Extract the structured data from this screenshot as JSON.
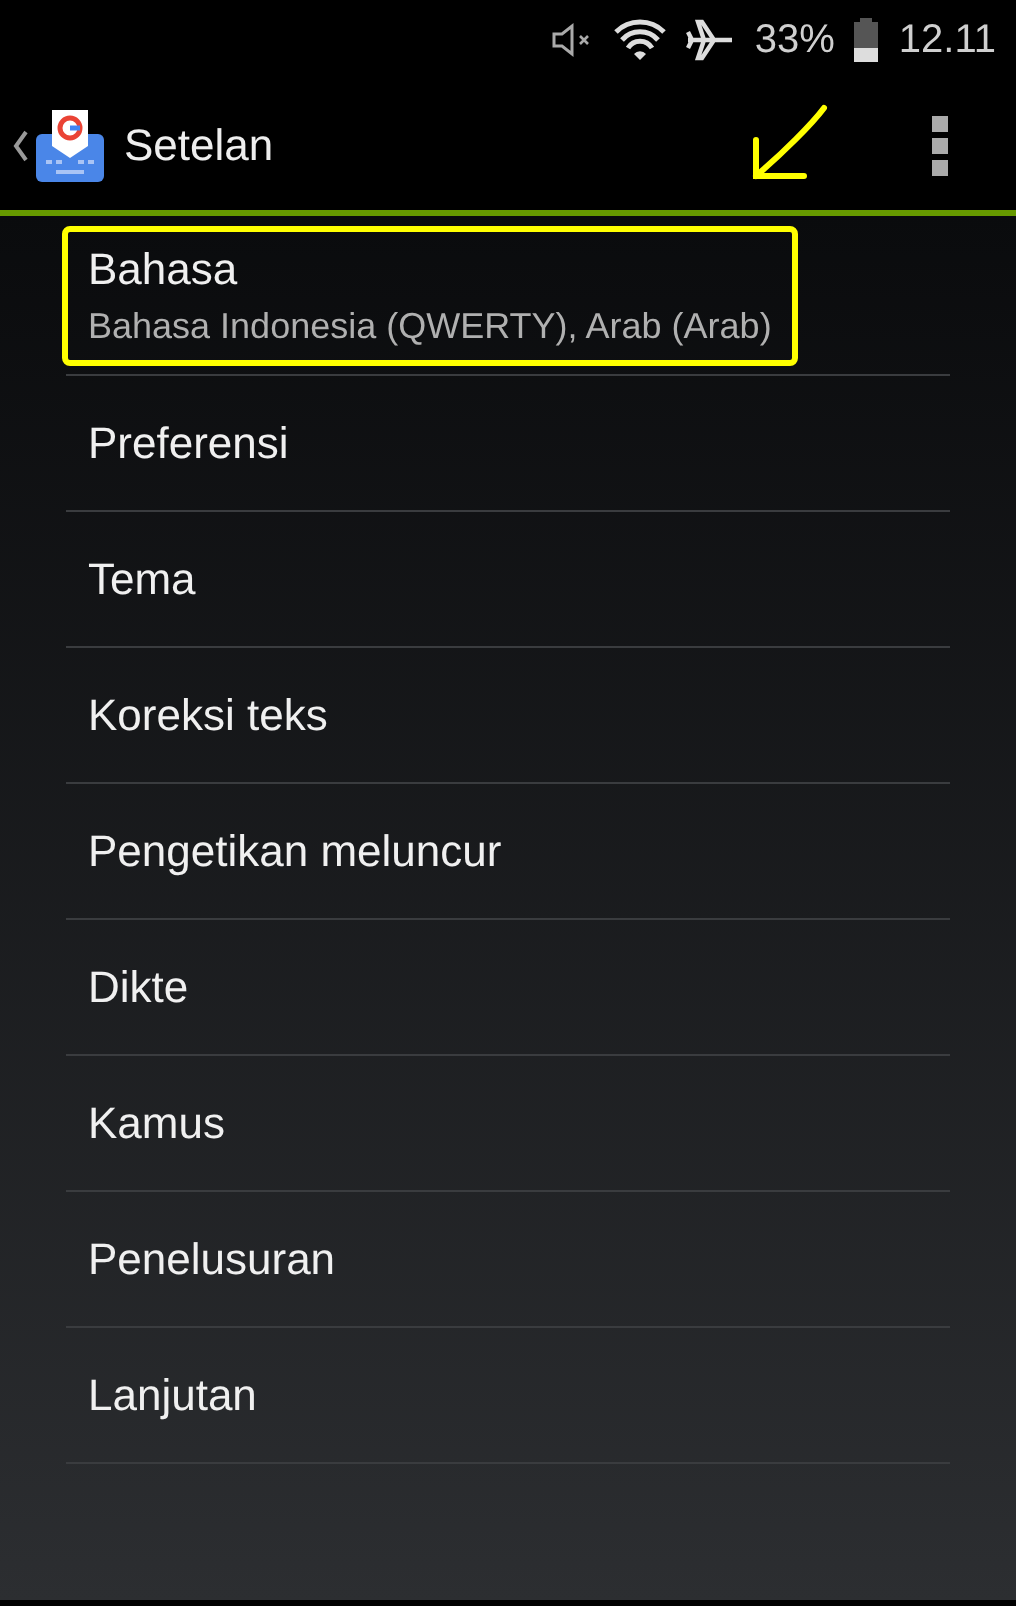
{
  "status_bar": {
    "battery": "33%",
    "time": "12.11"
  },
  "app_bar": {
    "title": "Setelan"
  },
  "items": [
    {
      "title": "Bahasa",
      "subtitle": "Bahasa Indonesia (QWERTY), Arab (Arab)",
      "highlighted": true
    },
    {
      "title": "Preferensi",
      "highlighted": false
    },
    {
      "title": "Tema",
      "highlighted": false
    },
    {
      "title": "Koreksi teks",
      "highlighted": false
    },
    {
      "title": "Pengetikan meluncur",
      "highlighted": false
    },
    {
      "title": "Dikte",
      "highlighted": false
    },
    {
      "title": "Kamus",
      "highlighted": false
    },
    {
      "title": "Penelusuran",
      "highlighted": false
    },
    {
      "title": "Lanjutan",
      "highlighted": false
    }
  ]
}
